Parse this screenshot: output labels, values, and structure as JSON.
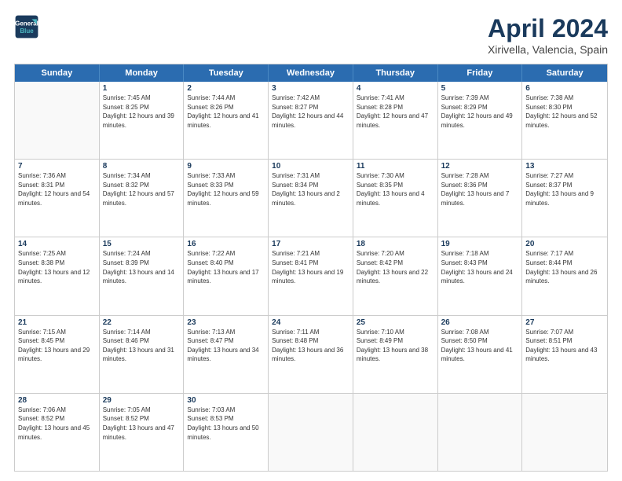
{
  "header": {
    "logo_line1": "General",
    "logo_line2": "Blue",
    "title": "April 2024",
    "subtitle": "Xirivella, Valencia, Spain"
  },
  "calendar": {
    "days_of_week": [
      "Sunday",
      "Monday",
      "Tuesday",
      "Wednesday",
      "Thursday",
      "Friday",
      "Saturday"
    ],
    "rows": [
      [
        {
          "day": "",
          "sunrise": "",
          "sunset": "",
          "daylight": ""
        },
        {
          "day": "1",
          "sunrise": "Sunrise: 7:45 AM",
          "sunset": "Sunset: 8:25 PM",
          "daylight": "Daylight: 12 hours and 39 minutes."
        },
        {
          "day": "2",
          "sunrise": "Sunrise: 7:44 AM",
          "sunset": "Sunset: 8:26 PM",
          "daylight": "Daylight: 12 hours and 41 minutes."
        },
        {
          "day": "3",
          "sunrise": "Sunrise: 7:42 AM",
          "sunset": "Sunset: 8:27 PM",
          "daylight": "Daylight: 12 hours and 44 minutes."
        },
        {
          "day": "4",
          "sunrise": "Sunrise: 7:41 AM",
          "sunset": "Sunset: 8:28 PM",
          "daylight": "Daylight: 12 hours and 47 minutes."
        },
        {
          "day": "5",
          "sunrise": "Sunrise: 7:39 AM",
          "sunset": "Sunset: 8:29 PM",
          "daylight": "Daylight: 12 hours and 49 minutes."
        },
        {
          "day": "6",
          "sunrise": "Sunrise: 7:38 AM",
          "sunset": "Sunset: 8:30 PM",
          "daylight": "Daylight: 12 hours and 52 minutes."
        }
      ],
      [
        {
          "day": "7",
          "sunrise": "Sunrise: 7:36 AM",
          "sunset": "Sunset: 8:31 PM",
          "daylight": "Daylight: 12 hours and 54 minutes."
        },
        {
          "day": "8",
          "sunrise": "Sunrise: 7:34 AM",
          "sunset": "Sunset: 8:32 PM",
          "daylight": "Daylight: 12 hours and 57 minutes."
        },
        {
          "day": "9",
          "sunrise": "Sunrise: 7:33 AM",
          "sunset": "Sunset: 8:33 PM",
          "daylight": "Daylight: 12 hours and 59 minutes."
        },
        {
          "day": "10",
          "sunrise": "Sunrise: 7:31 AM",
          "sunset": "Sunset: 8:34 PM",
          "daylight": "Daylight: 13 hours and 2 minutes."
        },
        {
          "day": "11",
          "sunrise": "Sunrise: 7:30 AM",
          "sunset": "Sunset: 8:35 PM",
          "daylight": "Daylight: 13 hours and 4 minutes."
        },
        {
          "day": "12",
          "sunrise": "Sunrise: 7:28 AM",
          "sunset": "Sunset: 8:36 PM",
          "daylight": "Daylight: 13 hours and 7 minutes."
        },
        {
          "day": "13",
          "sunrise": "Sunrise: 7:27 AM",
          "sunset": "Sunset: 8:37 PM",
          "daylight": "Daylight: 13 hours and 9 minutes."
        }
      ],
      [
        {
          "day": "14",
          "sunrise": "Sunrise: 7:25 AM",
          "sunset": "Sunset: 8:38 PM",
          "daylight": "Daylight: 13 hours and 12 minutes."
        },
        {
          "day": "15",
          "sunrise": "Sunrise: 7:24 AM",
          "sunset": "Sunset: 8:39 PM",
          "daylight": "Daylight: 13 hours and 14 minutes."
        },
        {
          "day": "16",
          "sunrise": "Sunrise: 7:22 AM",
          "sunset": "Sunset: 8:40 PM",
          "daylight": "Daylight: 13 hours and 17 minutes."
        },
        {
          "day": "17",
          "sunrise": "Sunrise: 7:21 AM",
          "sunset": "Sunset: 8:41 PM",
          "daylight": "Daylight: 13 hours and 19 minutes."
        },
        {
          "day": "18",
          "sunrise": "Sunrise: 7:20 AM",
          "sunset": "Sunset: 8:42 PM",
          "daylight": "Daylight: 13 hours and 22 minutes."
        },
        {
          "day": "19",
          "sunrise": "Sunrise: 7:18 AM",
          "sunset": "Sunset: 8:43 PM",
          "daylight": "Daylight: 13 hours and 24 minutes."
        },
        {
          "day": "20",
          "sunrise": "Sunrise: 7:17 AM",
          "sunset": "Sunset: 8:44 PM",
          "daylight": "Daylight: 13 hours and 26 minutes."
        }
      ],
      [
        {
          "day": "21",
          "sunrise": "Sunrise: 7:15 AM",
          "sunset": "Sunset: 8:45 PM",
          "daylight": "Daylight: 13 hours and 29 minutes."
        },
        {
          "day": "22",
          "sunrise": "Sunrise: 7:14 AM",
          "sunset": "Sunset: 8:46 PM",
          "daylight": "Daylight: 13 hours and 31 minutes."
        },
        {
          "day": "23",
          "sunrise": "Sunrise: 7:13 AM",
          "sunset": "Sunset: 8:47 PM",
          "daylight": "Daylight: 13 hours and 34 minutes."
        },
        {
          "day": "24",
          "sunrise": "Sunrise: 7:11 AM",
          "sunset": "Sunset: 8:48 PM",
          "daylight": "Daylight: 13 hours and 36 minutes."
        },
        {
          "day": "25",
          "sunrise": "Sunrise: 7:10 AM",
          "sunset": "Sunset: 8:49 PM",
          "daylight": "Daylight: 13 hours and 38 minutes."
        },
        {
          "day": "26",
          "sunrise": "Sunrise: 7:08 AM",
          "sunset": "Sunset: 8:50 PM",
          "daylight": "Daylight: 13 hours and 41 minutes."
        },
        {
          "day": "27",
          "sunrise": "Sunrise: 7:07 AM",
          "sunset": "Sunset: 8:51 PM",
          "daylight": "Daylight: 13 hours and 43 minutes."
        }
      ],
      [
        {
          "day": "28",
          "sunrise": "Sunrise: 7:06 AM",
          "sunset": "Sunset: 8:52 PM",
          "daylight": "Daylight: 13 hours and 45 minutes."
        },
        {
          "day": "29",
          "sunrise": "Sunrise: 7:05 AM",
          "sunset": "Sunset: 8:52 PM",
          "daylight": "Daylight: 13 hours and 47 minutes."
        },
        {
          "day": "30",
          "sunrise": "Sunrise: 7:03 AM",
          "sunset": "Sunset: 8:53 PM",
          "daylight": "Daylight: 13 hours and 50 minutes."
        },
        {
          "day": "",
          "sunrise": "",
          "sunset": "",
          "daylight": ""
        },
        {
          "day": "",
          "sunrise": "",
          "sunset": "",
          "daylight": ""
        },
        {
          "day": "",
          "sunrise": "",
          "sunset": "",
          "daylight": ""
        },
        {
          "day": "",
          "sunrise": "",
          "sunset": "",
          "daylight": ""
        }
      ]
    ]
  }
}
